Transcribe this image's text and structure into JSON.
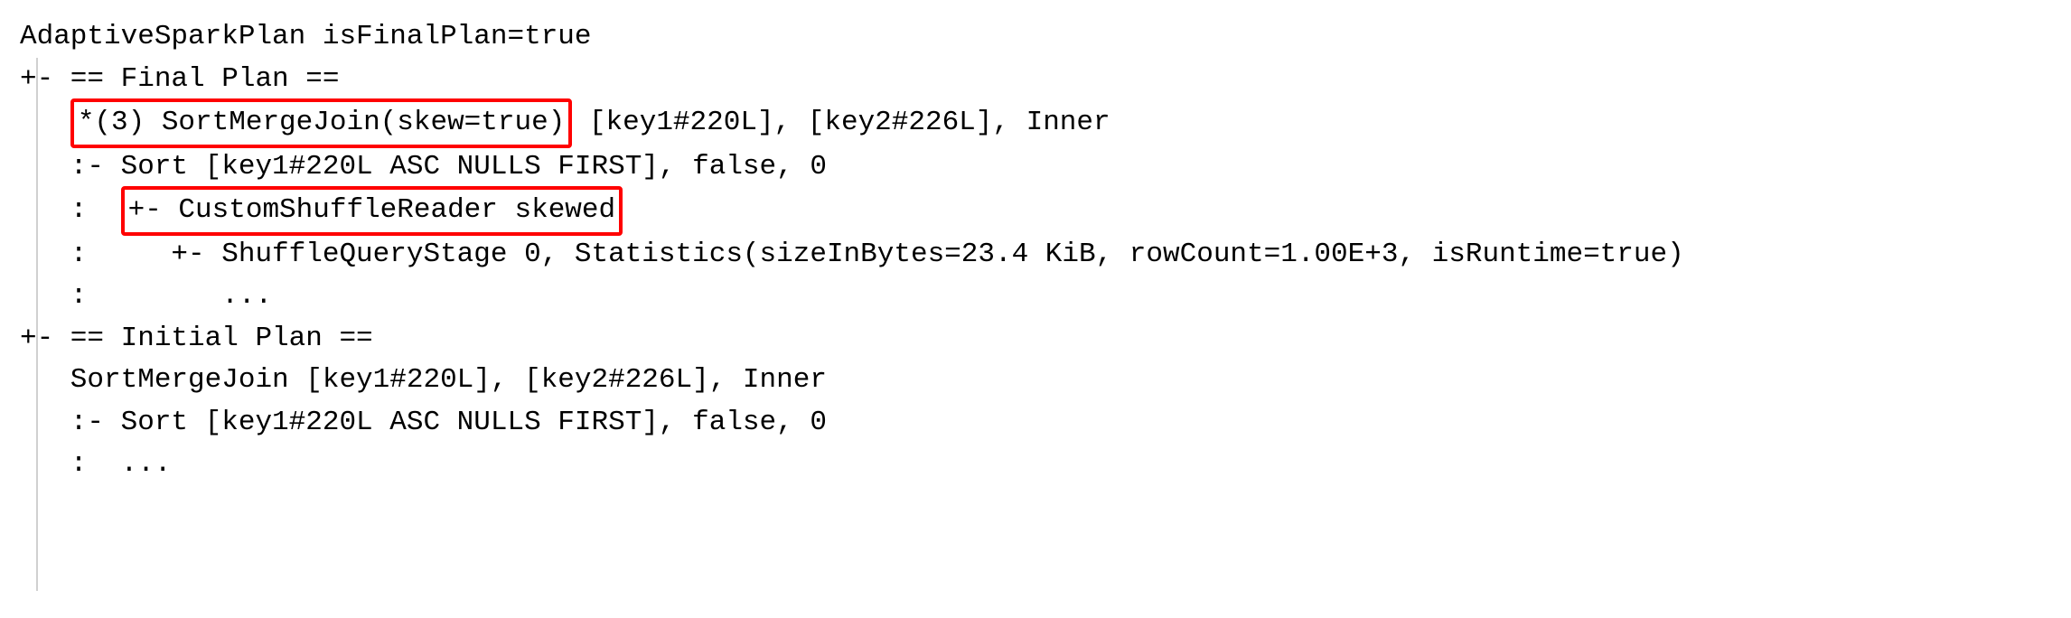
{
  "plan": {
    "line1": "AdaptiveSparkPlan isFinalPlan=true",
    "line2": "+- == Final Plan ==",
    "line3_prefix": "   ",
    "line3_box": "*(3) SortMergeJoin(skew=true)",
    "line3_suffix": " [key1#220L], [key2#226L], Inner",
    "line4": "   :- Sort [key1#220L ASC NULLS FIRST], false, 0",
    "line5_prefix": "   :  ",
    "line5_box": "+- CustomShuffleReader skewed",
    "line6": "   :     +- ShuffleQueryStage 0, Statistics(sizeInBytes=23.4 KiB, rowCount=1.00E+3, isRuntime=true)",
    "line7": "   :        ...",
    "line8": "+- == Initial Plan ==",
    "line9": "   SortMergeJoin [key1#220L], [key2#226L], Inner",
    "line10": "   :- Sort [key1#220L ASC NULLS FIRST], false, 0",
    "line11": "   :  ..."
  }
}
